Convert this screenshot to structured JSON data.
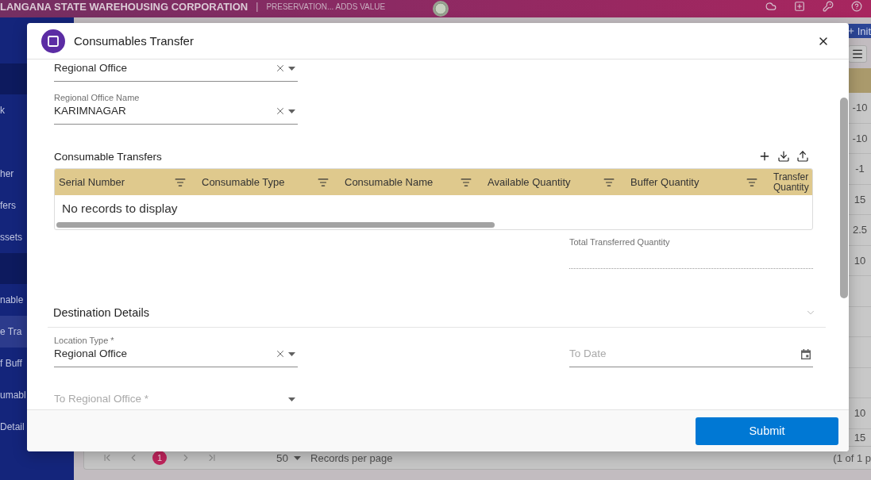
{
  "app_header": {
    "title": "LANGANA STATE WAREHOUSING CORPORATION",
    "separator": "|",
    "tagline": "PRESERVATION... ADDS VALUE"
  },
  "sidebar": {
    "entries": [
      {
        "kind": "group"
      },
      {
        "kind": "item",
        "label": "k",
        "selected": false
      },
      {
        "kind": "blank"
      },
      {
        "kind": "item",
        "label": "her",
        "selected": false
      },
      {
        "kind": "item",
        "label": "fers",
        "selected": false
      },
      {
        "kind": "item",
        "label": "ssets",
        "selected": false
      },
      {
        "kind": "group"
      },
      {
        "kind": "item",
        "label": "nable",
        "selected": false
      },
      {
        "kind": "item",
        "label": "e Tra",
        "selected": true
      },
      {
        "kind": "item",
        "label": "f Buff",
        "selected": false
      },
      {
        "kind": "item",
        "label": "umabl",
        "selected": false
      },
      {
        "kind": "item",
        "label": "Detail",
        "selected": false
      }
    ]
  },
  "records_table": {
    "add_button": "Init",
    "rows": [
      {
        "value": "-10"
      },
      {
        "value": "-10"
      },
      {
        "value": "-1"
      },
      {
        "value": "15"
      },
      {
        "value": "2.5"
      },
      {
        "value": "10"
      },
      {},
      {},
      {},
      {},
      {
        "value": "10"
      },
      {
        "value": "15"
      }
    ]
  },
  "pager": {
    "pages": [
      {
        "label": "1",
        "selected": true
      }
    ],
    "page_size": "50",
    "page_size_label": "Records per page",
    "summary": "(1 of 1 p"
  },
  "dialog": {
    "title": "Consumables Transfer",
    "source_fields": [
      {
        "kind": "select",
        "value": "Regional Office",
        "clearable": true
      },
      {
        "kind": "select",
        "label": "Regional Office Name",
        "value": "KARIMNAGAR",
        "clearable": true
      }
    ],
    "transfers": {
      "title": "Consumable Transfers",
      "columns": [
        {
          "label": "Serial Number",
          "filter": true
        },
        {
          "label": "Consumable Type",
          "filter": true
        },
        {
          "label": "Consumable Name",
          "filter": true
        },
        {
          "label": "Available Quantity",
          "filter": true
        },
        {
          "label": "Buffer Quantity",
          "filter": true
        },
        {
          "label": "Transfer Quantity",
          "filter": false
        }
      ],
      "empty_text": "No records to display"
    },
    "total_field": {
      "kind": "readonly",
      "label": "Total Transferred Quantity"
    },
    "destination": {
      "title": "Destination Details",
      "expanded": true,
      "left_fields": [
        {
          "kind": "select",
          "label": "Location Type *",
          "value": "Regional Office",
          "clearable": true
        },
        {
          "kind": "select",
          "placeholder": "To Regional Office *",
          "clearable": false
        }
      ],
      "right_fields": [
        {
          "kind": "date",
          "placeholder": "To Date"
        }
      ]
    },
    "submit_button": "Submit"
  }
}
